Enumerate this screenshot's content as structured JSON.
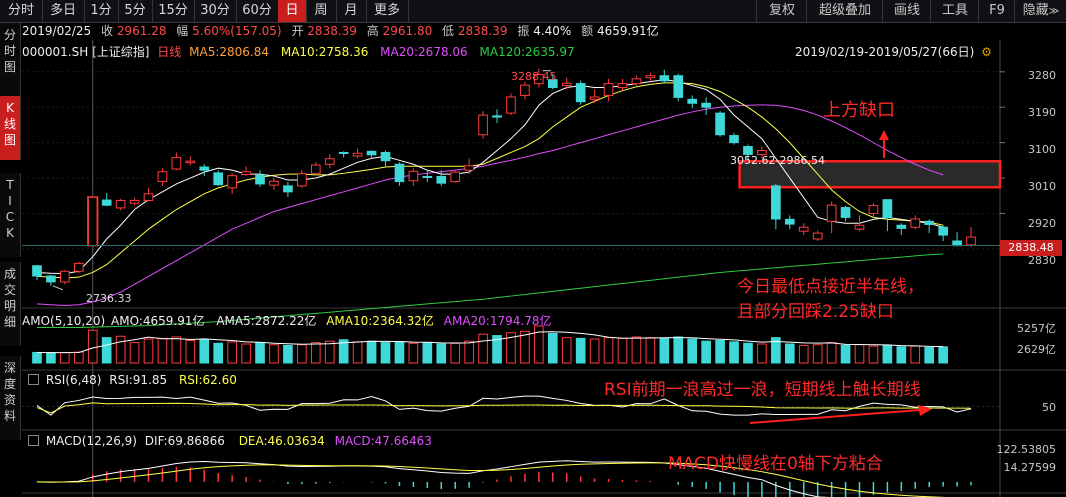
{
  "toolbar": {
    "tabs": [
      "分时",
      "多日",
      "1分",
      "5分",
      "15分",
      "30分",
      "60分",
      "日",
      "周",
      "月",
      "更多"
    ],
    "active_tab": "日",
    "right_buttons": [
      "复权",
      "超级叠加",
      "画线",
      "工具",
      "F9",
      "隐藏"
    ]
  },
  "side_tabs": {
    "fenshi": "分时图",
    "kline": "K线图",
    "tick": "TICK",
    "chengjiao": "成交明细",
    "shendu": "深度资料"
  },
  "info": {
    "date": "2019/02/25",
    "close_label": "收",
    "close": "2961.28",
    "change_label": "幅",
    "change": "5.60%(157.05)",
    "open_label": "开",
    "open": "2838.39",
    "high_label": "高",
    "high": "2961.80",
    "low_label": "低",
    "low": "2838.39",
    "amp_label": "振",
    "amp": "4.40%",
    "amount_label": "额",
    "amount": "4659.91亿"
  },
  "kline": {
    "symbol": "000001.SH",
    "name": "[上证综指]",
    "type": "日线",
    "ma5": "MA5:2806.84",
    "ma10": "MA10:2758.36",
    "ma20": "MA20:2678.06",
    "ma120": "MA120:2635.97",
    "range": "2019/02/19-2019/05/27(66日)",
    "y_ticks": [
      "3280",
      "3190",
      "3100",
      "3010",
      "2920",
      "2830"
    ],
    "last_price": "2838.48",
    "high_mark": "3288.45",
    "low_mark": "2736.33",
    "gap_mark": "3052.62-2986.54"
  },
  "amo": {
    "label": "AMO(5,10,20)",
    "amo": "AMO:4659.91亿",
    "ama5": "AMA5:2872.22亿",
    "ama10": "AMA10:2364.32亿",
    "ama20": "AMA20:1794.78亿",
    "y_ticks": [
      "5257亿",
      "2629亿"
    ]
  },
  "rsi": {
    "label": "RSI(6,48)",
    "rsi1": "RSI:91.85",
    "rsi2": "RSI:62.60",
    "y_ticks": [
      "50"
    ]
  },
  "macd": {
    "label": "MACD(12,26,9)",
    "dif": "DIF:69.86866",
    "dea": "DEA:46.03634",
    "macd": "MACD:47.66463",
    "y_ticks": [
      "122.53805",
      "14.27599"
    ]
  },
  "annotations": {
    "gap_up": "上方缺口",
    "low_line1": "今日最低点接近半年线，",
    "low_line2": "且部分回踩2.25缺口",
    "rsi_note": "RSI前期一浪高过一浪，短期线上触长期线",
    "macd_note": "MACD快慢线在0轴下方粘合"
  },
  "colors": {
    "up": "#ff3b3b",
    "down": "#3fd8d8",
    "ma5": "#ff9f3f",
    "ma10": "#ffff48",
    "ma20": "#e04dff",
    "ma120": "#2ecc40",
    "active": "#c81e1e",
    "annotation": "#ff2a2a"
  },
  "chart_data": {
    "type": "candlestick",
    "candles": [
      {
        "o": 2787,
        "c": 2761,
        "h": 2789,
        "l": 2751
      },
      {
        "o": 2761,
        "c": 2746,
        "h": 2764,
        "l": 2736
      },
      {
        "o": 2746,
        "c": 2773,
        "h": 2776,
        "l": 2740
      },
      {
        "o": 2773,
        "c": 2793,
        "h": 2797,
        "l": 2768
      },
      {
        "o": 2838,
        "c": 2961,
        "h": 2962,
        "l": 2838
      },
      {
        "o": 2954,
        "c": 2941,
        "h": 2972,
        "l": 2938
      },
      {
        "o": 2934,
        "c": 2953,
        "h": 2957,
        "l": 2928
      },
      {
        "o": 2946,
        "c": 2953,
        "h": 2960,
        "l": 2940
      },
      {
        "o": 2953,
        "c": 2970,
        "h": 2985,
        "l": 2950
      },
      {
        "o": 3001,
        "c": 3026,
        "h": 3035,
        "l": 2990
      },
      {
        "o": 3033,
        "c": 3062,
        "h": 3075,
        "l": 3030
      },
      {
        "o": 3049,
        "c": 3053,
        "h": 3065,
        "l": 3042
      },
      {
        "o": 3038,
        "c": 3030,
        "h": 3045,
        "l": 3015
      },
      {
        "o": 3023,
        "c": 2993,
        "h": 3030,
        "l": 2990
      },
      {
        "o": 2985,
        "c": 3016,
        "h": 3023,
        "l": 2970
      },
      {
        "o": 3019,
        "c": 3026,
        "h": 3040,
        "l": 3015
      },
      {
        "o": 3017,
        "c": 2995,
        "h": 3030,
        "l": 2988
      },
      {
        "o": 2992,
        "c": 3002,
        "h": 3010,
        "l": 2980
      },
      {
        "o": 2990,
        "c": 2975,
        "h": 3000,
        "l": 2962
      },
      {
        "o": 2990,
        "c": 3021,
        "h": 3030,
        "l": 2985
      },
      {
        "o": 3022,
        "c": 3043,
        "h": 3050,
        "l": 3018
      },
      {
        "o": 3045,
        "c": 3059,
        "h": 3070,
        "l": 3035
      },
      {
        "o": 3075,
        "c": 3073,
        "h": 3078,
        "l": 3062
      },
      {
        "o": 3066,
        "c": 3073,
        "h": 3085,
        "l": 3060
      },
      {
        "o": 3078,
        "c": 3069,
        "h": 3080,
        "l": 3058
      },
      {
        "o": 3075,
        "c": 3054,
        "h": 3080,
        "l": 3040
      },
      {
        "o": 3045,
        "c": 3001,
        "h": 3050,
        "l": 2990
      },
      {
        "o": 3003,
        "c": 3027,
        "h": 3035,
        "l": 2990
      },
      {
        "o": 3014,
        "c": 3013,
        "h": 3030,
        "l": 3000
      },
      {
        "o": 3014,
        "c": 2997,
        "h": 3030,
        "l": 2990
      },
      {
        "o": 3001,
        "c": 3025,
        "h": 3030,
        "l": 2998
      },
      {
        "o": 3030,
        "c": 3041,
        "h": 3060,
        "l": 3020
      },
      {
        "o": 3120,
        "c": 3170,
        "h": 3180,
        "l": 3110
      },
      {
        "o": 3168,
        "c": 3165,
        "h": 3185,
        "l": 3150
      },
      {
        "o": 3175,
        "c": 3216,
        "h": 3225,
        "l": 3170
      },
      {
        "o": 3220,
        "c": 3246,
        "h": 3255,
        "l": 3210
      },
      {
        "o": 3250,
        "c": 3273,
        "h": 3288,
        "l": 3240
      },
      {
        "o": 3260,
        "c": 3240,
        "h": 3275,
        "l": 3235
      },
      {
        "o": 3245,
        "c": 3251,
        "h": 3265,
        "l": 3235
      },
      {
        "o": 3250,
        "c": 3204,
        "h": 3258,
        "l": 3196
      },
      {
        "o": 3210,
        "c": 3216,
        "h": 3235,
        "l": 3200
      },
      {
        "o": 3220,
        "c": 3250,
        "h": 3262,
        "l": 3205
      },
      {
        "o": 3240,
        "c": 3250,
        "h": 3262,
        "l": 3232
      },
      {
        "o": 3250,
        "c": 3262,
        "h": 3270,
        "l": 3245
      },
      {
        "o": 3265,
        "c": 3270,
        "h": 3278,
        "l": 3258
      },
      {
        "o": 3270,
        "c": 3257,
        "h": 3285,
        "l": 3250
      },
      {
        "o": 3270,
        "c": 3215,
        "h": 3275,
        "l": 3205
      },
      {
        "o": 3210,
        "c": 3200,
        "h": 3220,
        "l": 3188
      },
      {
        "o": 3200,
        "c": 3190,
        "h": 3215,
        "l": 3170
      },
      {
        "o": 3175,
        "c": 3120,
        "h": 3180,
        "l": 3115
      },
      {
        "o": 3118,
        "c": 3100,
        "h": 3125,
        "l": 3095
      },
      {
        "o": 3090,
        "c": 3070,
        "h": 3095,
        "l": 3055
      },
      {
        "o": 3070,
        "c": 3080,
        "h": 3090,
        "l": 3060
      },
      {
        "o": 2990,
        "c": 2906,
        "h": 2995,
        "l": 2880
      },
      {
        "o": 2905,
        "c": 2893,
        "h": 2915,
        "l": 2880
      },
      {
        "o": 2875,
        "c": 2885,
        "h": 2895,
        "l": 2865
      },
      {
        "o": 2855,
        "c": 2870,
        "h": 2877,
        "l": 2850
      },
      {
        "o": 2900,
        "c": 2941,
        "h": 2950,
        "l": 2870
      },
      {
        "o": 2935,
        "c": 2910,
        "h": 2940,
        "l": 2900
      },
      {
        "o": 2880,
        "c": 2890,
        "h": 2915,
        "l": 2875
      },
      {
        "o": 2920,
        "c": 2940,
        "h": 2945,
        "l": 2912
      },
      {
        "o": 2955,
        "c": 2909,
        "h": 2955,
        "l": 2875
      },
      {
        "o": 2890,
        "c": 2882,
        "h": 2895,
        "l": 2865
      },
      {
        "o": 2885,
        "c": 2906,
        "h": 2915,
        "l": 2880
      },
      {
        "o": 2900,
        "c": 2892,
        "h": 2905,
        "l": 2870
      },
      {
        "o": 2885,
        "c": 2865,
        "h": 2890,
        "l": 2850
      },
      {
        "o": 2850,
        "c": 2838,
        "h": 2872,
        "l": 2836
      },
      {
        "o": 2840,
        "c": 2860,
        "h": 2885,
        "l": 2835
      }
    ],
    "ma5": [
      2770,
      2768,
      2767,
      2773,
      2810,
      2855,
      2890,
      2930,
      2955,
      2975,
      2995,
      3010,
      3025,
      3035,
      3030,
      3020,
      3020,
      3015,
      3005,
      3005,
      3010,
      3020,
      3035,
      3050,
      3060,
      3065,
      3055,
      3045,
      3030,
      3020,
      3020,
      3025,
      3050,
      3080,
      3110,
      3145,
      3195,
      3225,
      3240,
      3245,
      3240,
      3240,
      3245,
      3250,
      3255,
      3260,
      3255,
      3245,
      3235,
      3210,
      3170,
      3140,
      3110,
      3060,
      3010,
      2960,
      2910,
      2900,
      2895,
      2895,
      2905,
      2910,
      2905,
      2900,
      2895,
      2885
    ],
    "ma10": [
      2760,
      2758,
      2756,
      2758,
      2770,
      2790,
      2820,
      2850,
      2880,
      2905,
      2930,
      2950,
      2970,
      2985,
      2995,
      3005,
      3012,
      3017,
      3020,
      3020,
      3018,
      3018,
      3022,
      3027,
      3032,
      3038,
      3040,
      3040,
      3040,
      3040,
      3040,
      3040,
      3045,
      3060,
      3075,
      3090,
      3110,
      3140,
      3165,
      3190,
      3205,
      3220,
      3232,
      3242,
      3248,
      3252,
      3252,
      3250,
      3242,
      3230,
      3210,
      3190,
      3165,
      3135,
      3100,
      3060,
      3020,
      2980,
      2950,
      2925,
      2910,
      2905,
      2903,
      2900,
      2898,
      2890
    ],
    "ma20": [
      2690,
      2688,
      2686,
      2688,
      2695,
      2705,
      2720,
      2740,
      2760,
      2780,
      2800,
      2820,
      2840,
      2860,
      2880,
      2895,
      2910,
      2925,
      2935,
      2945,
      2955,
      2965,
      2975,
      2985,
      2995,
      3005,
      3012,
      3018,
      3022,
      3026,
      3030,
      3035,
      3040,
      3048,
      3055,
      3063,
      3072,
      3080,
      3090,
      3100,
      3110,
      3120,
      3130,
      3140,
      3150,
      3160,
      3170,
      3178,
      3185,
      3190,
      3193,
      3195,
      3196,
      3195,
      3190,
      3182,
      3170,
      3155,
      3138,
      3120,
      3100,
      3080,
      3062,
      3045,
      3030,
      3018
    ],
    "ma120": [
      2630,
      2630,
      2630,
      2630,
      2631,
      2632,
      2633,
      2634,
      2635,
      2637,
      2639,
      2641,
      2643,
      2645,
      2648,
      2651,
      2654,
      2657,
      2660,
      2663,
      2666,
      2669,
      2672,
      2675,
      2678,
      2681,
      2684,
      2687,
      2690,
      2693,
      2696,
      2699,
      2702,
      2706,
      2710,
      2714,
      2718,
      2722,
      2726,
      2730,
      2734,
      2738,
      2742,
      2746,
      2750,
      2754,
      2758,
      2762,
      2766,
      2770,
      2773,
      2776,
      2779,
      2782,
      2785,
      2788,
      2791,
      2794,
      2797,
      2800,
      2803,
      2806,
      2809,
      2812,
      2815,
      2817
    ],
    "amo": [
      1500,
      1450,
      1480,
      1550,
      4659,
      3600,
      3800,
      2900,
      3400,
      3500,
      3700,
      3200,
      3300,
      2800,
      3000,
      2700,
      2900,
      2600,
      2500,
      2600,
      2900,
      3100,
      3300,
      3000,
      3100,
      2900,
      3000,
      2800,
      2900,
      2700,
      2800,
      3100,
      4100,
      3900,
      4300,
      4500,
      5257,
      4200,
      3600,
      3500,
      3400,
      3600,
      3500,
      3700,
      3600,
      3500,
      3700,
      3400,
      3100,
      3200,
      3000,
      2800,
      2700,
      3600,
      2700,
      2500,
      2600,
      2900,
      2500,
      2600,
      2400,
      2500,
      2300,
      2400,
      2200,
      2300
    ],
    "amo_ylim": [
      0,
      5257
    ],
    "rsi_ylim": [
      0,
      100
    ],
    "macd_ylim": [
      -40,
      122.53805
    ]
  }
}
